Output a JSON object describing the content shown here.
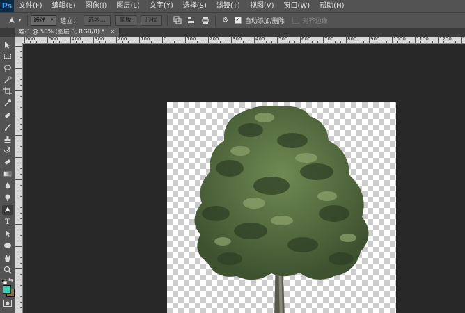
{
  "app": {
    "logo": "Ps"
  },
  "menu": [
    "文件(F)",
    "编辑(E)",
    "图像(I)",
    "图层(L)",
    "文字(Y)",
    "选择(S)",
    "滤镜(T)",
    "视图(V)",
    "窗口(W)",
    "帮助(H)"
  ],
  "options": {
    "mode_select": "路径",
    "make_label": "建立：",
    "selection_button": "选区...",
    "mask_button": "蒙版",
    "shape_button": "形状",
    "auto_add_delete_label": "自动添加/删除",
    "auto_add_delete_checked": true,
    "align_edges_label": "对齐边缘",
    "align_edges_checked": false
  },
  "document_tab": {
    "title": "题-1 @ 50% (图层 3, RGB/8) *",
    "close_symbol": "×"
  },
  "ruler": {
    "labels": [
      "600",
      "500",
      "400",
      "300",
      "200",
      "100",
      "0",
      "100",
      "200",
      "300",
      "400",
      "500",
      "600",
      "700",
      "800",
      "900",
      "1000",
      "1100",
      "1200",
      "1300"
    ]
  },
  "colors": {
    "foreground": "#2ed3b6",
    "background": "#8a6a49"
  },
  "tools": [
    "move-tool",
    "marquee-tool",
    "lasso-tool",
    "quick-selection-tool",
    "crop-tool",
    "eyedropper-tool",
    "spot-healing-tool",
    "brush-tool",
    "clone-stamp-tool",
    "history-brush-tool",
    "eraser-tool",
    "gradient-tool",
    "blur-tool",
    "dodge-tool",
    "pen-tool",
    "type-tool",
    "path-selection-tool",
    "ellipse-tool",
    "hand-tool",
    "zoom-tool"
  ]
}
